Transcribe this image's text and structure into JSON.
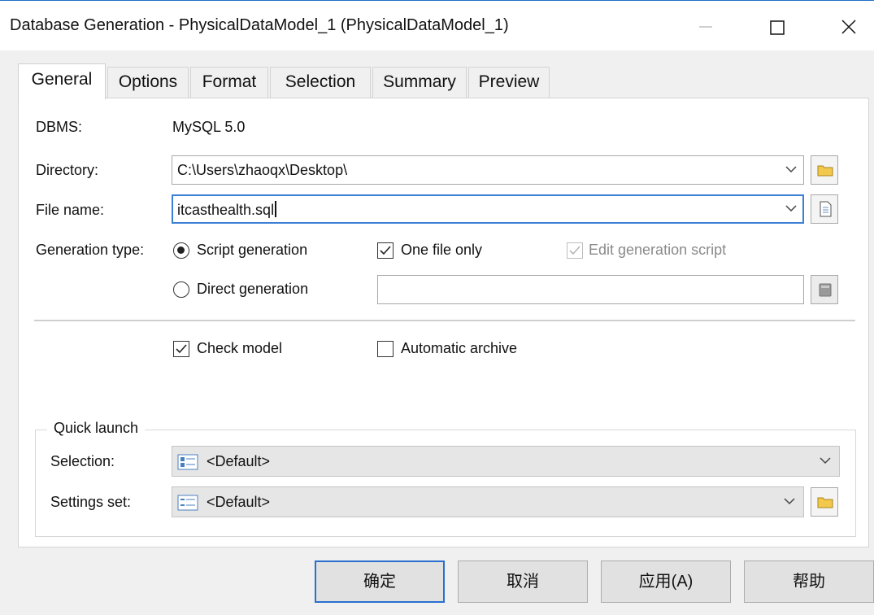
{
  "window": {
    "title": "Database Generation - PhysicalDataModel_1 (PhysicalDataModel_1)"
  },
  "tabs": [
    {
      "label": "General",
      "active": true
    },
    {
      "label": "Options"
    },
    {
      "label": "Format"
    },
    {
      "label": "Selection"
    },
    {
      "label": "Summary"
    },
    {
      "label": "Preview"
    }
  ],
  "general": {
    "dbms_label": "DBMS:",
    "dbms_value": "MySQL 5.0",
    "directory_label": "Directory:",
    "directory_value": "C:\\Users\\zhaoqx\\Desktop\\",
    "filename_label": "File name:",
    "filename_value": "itcasthealth.sql",
    "gentype_label": "Generation type:",
    "script_generation": "Script generation",
    "one_file_only": "One file only",
    "edit_generation_script": "Edit generation script",
    "direct_generation": "Direct generation",
    "direct_value": "",
    "check_model": "Check model",
    "automatic_archive": "Automatic archive"
  },
  "quick_launch": {
    "title": "Quick launch",
    "selection_label": "Selection:",
    "selection_value": "<Default>",
    "settings_label": "Settings set:",
    "settings_value": "<Default>"
  },
  "buttons": {
    "ok": "确定",
    "cancel": "取消",
    "apply": "应用(A)",
    "help": "帮助"
  },
  "colors": {
    "accent": "#2a6fd0",
    "folder": "#e8b830"
  }
}
